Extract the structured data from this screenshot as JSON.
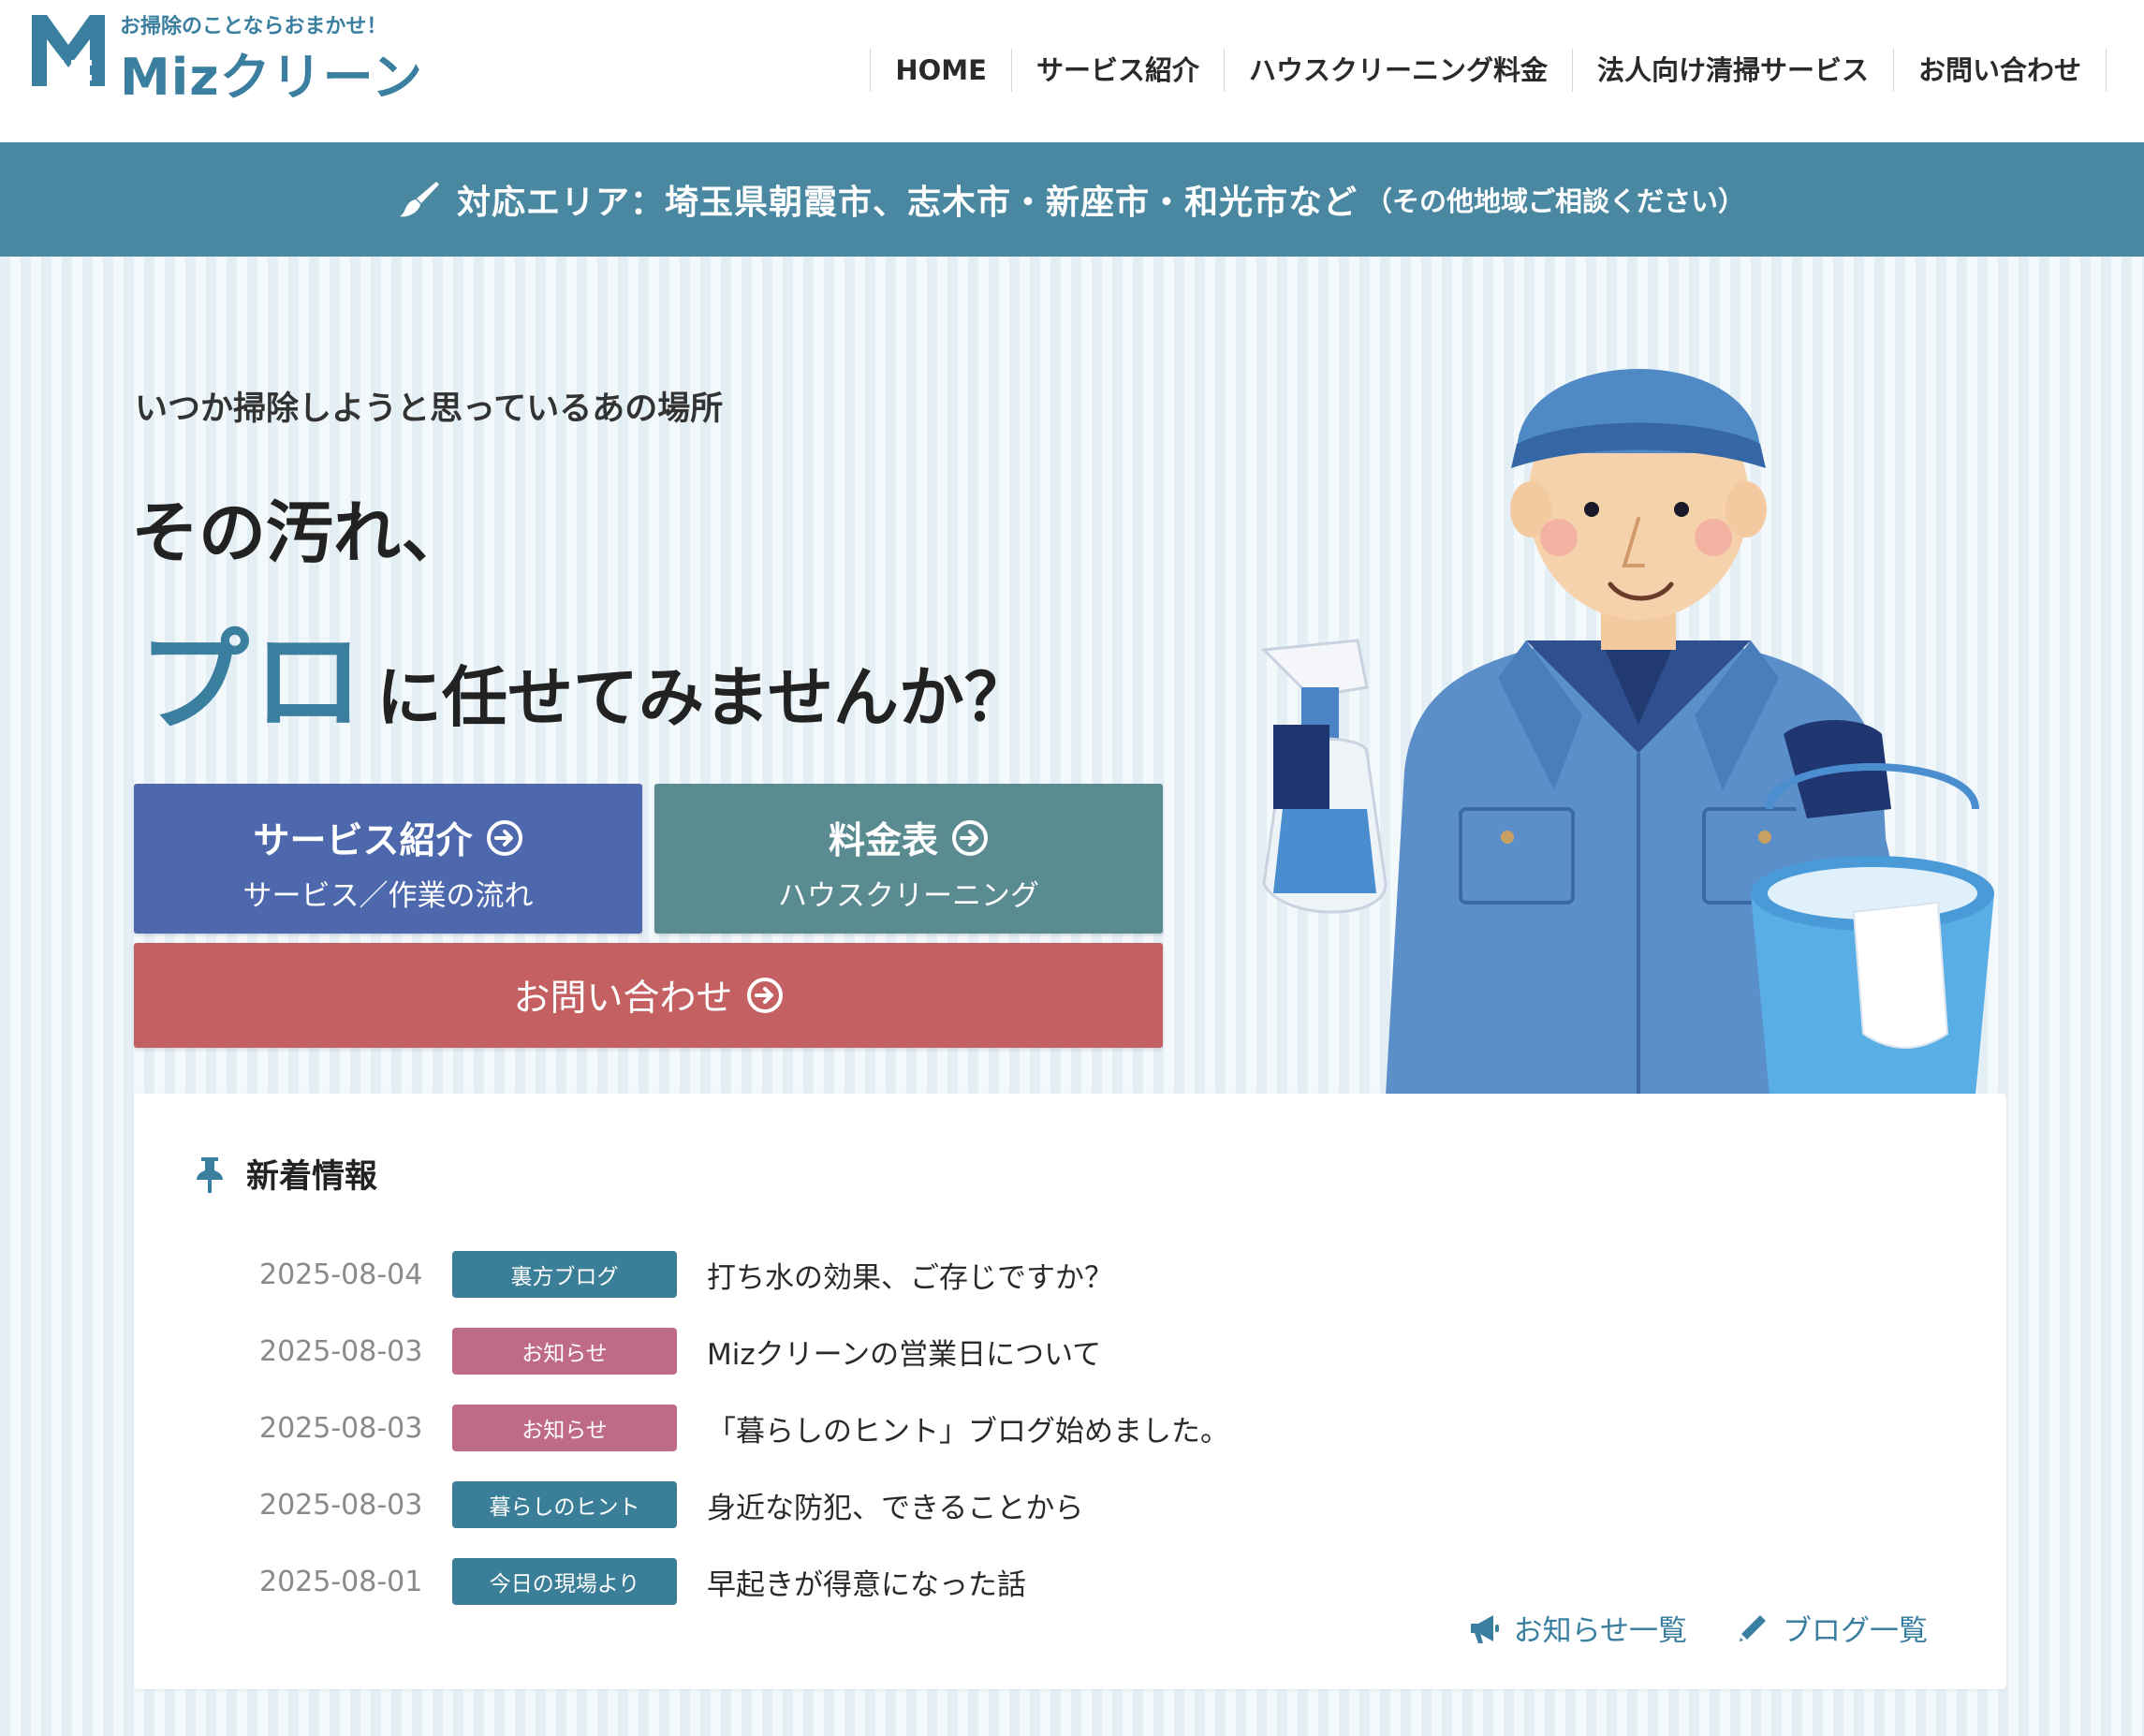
{
  "header": {
    "logo_tagline": "お掃除のことならおまかせ！",
    "logo_name": "Mizクリーン",
    "nav": [
      "HOME",
      "サービス紹介",
      "ハウスクリーニング料金",
      "法人向け清掃サービス",
      "お問い合わせ"
    ]
  },
  "area_bar": {
    "text": "対応エリア：埼玉県朝霞市、志木市・新座市・和光市など",
    "note": "（その他地域ご相談ください）",
    "icon": "brush-icon"
  },
  "hero": {
    "subtitle": "いつか掃除しようと思っているあの場所",
    "line1": "その汚れ、",
    "emphasis": "プロ",
    "line2_rest": "に任せてみませんか？",
    "buttons": {
      "service": {
        "title": "サービス紹介",
        "sub": "サービス／作業の流れ"
      },
      "price": {
        "title": "料金表",
        "sub": "ハウスクリーニング"
      },
      "contact": {
        "title": "お問い合わせ"
      }
    }
  },
  "news": {
    "title": "新着情報",
    "items": [
      {
        "date": "2025-08-04",
        "category": "裏方ブログ",
        "title": "打ち水の効果、ご存じですか？"
      },
      {
        "date": "2025-08-03",
        "category": "お知らせ",
        "title": "Mizクリーンの営業日について"
      },
      {
        "date": "2025-08-03",
        "category": "お知らせ",
        "title": "「暮らしのヒント」ブログ始めました。"
      },
      {
        "date": "2025-08-03",
        "category": "暮らしのヒント",
        "title": "身近な防犯、できることから"
      },
      {
        "date": "2025-08-01",
        "category": "今日の現場より",
        "title": "早起きが得意になった話"
      }
    ],
    "links": {
      "news_list": "お知らせ一覧",
      "blog_list": "ブログ一覧"
    }
  },
  "colors": {
    "brand": "#3a7fa0",
    "area_bar": "#4a87a1",
    "btn_service": "#4e68ae",
    "btn_price": "#5a8b91",
    "btn_contact": "#c46062",
    "badge_blog": "#3b7e97",
    "badge_notice": "#bf6b86"
  }
}
